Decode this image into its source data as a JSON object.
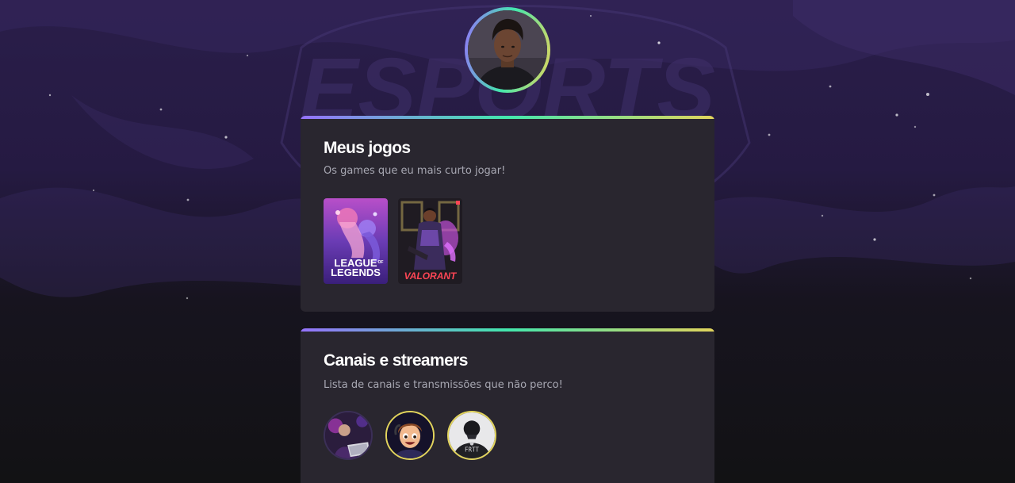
{
  "profile": {
    "avatar_icon": "profile-photo"
  },
  "games_card": {
    "title": "Meus jogos",
    "subtitle": "Os games que eu mais curto jogar!",
    "games": [
      {
        "name_line1": "LEAGUE",
        "name_of": "OF",
        "name_line2": "LEGENDS"
      },
      {
        "name": "VALORANT"
      }
    ]
  },
  "channels_card": {
    "title": "Canais e streamers",
    "subtitle": "Lista de canais e transmissões que não perco!",
    "channels": [
      {
        "icon": "streamer-avatar",
        "border_color": "#3b2f57"
      },
      {
        "icon": "cartoon-avatar",
        "border_color": "#e2d45c"
      },
      {
        "icon": "team-jersey-avatar",
        "border_color": "#e2d45c"
      }
    ]
  },
  "background": {
    "logo_text": "ESPORTS"
  },
  "colors": {
    "gradient_start": "#9572fc",
    "gradient_mid": "#43e7ad",
    "gradient_end": "#e2d45c",
    "card_bg": "#29262f",
    "subtitle": "#a8a8b3"
  }
}
